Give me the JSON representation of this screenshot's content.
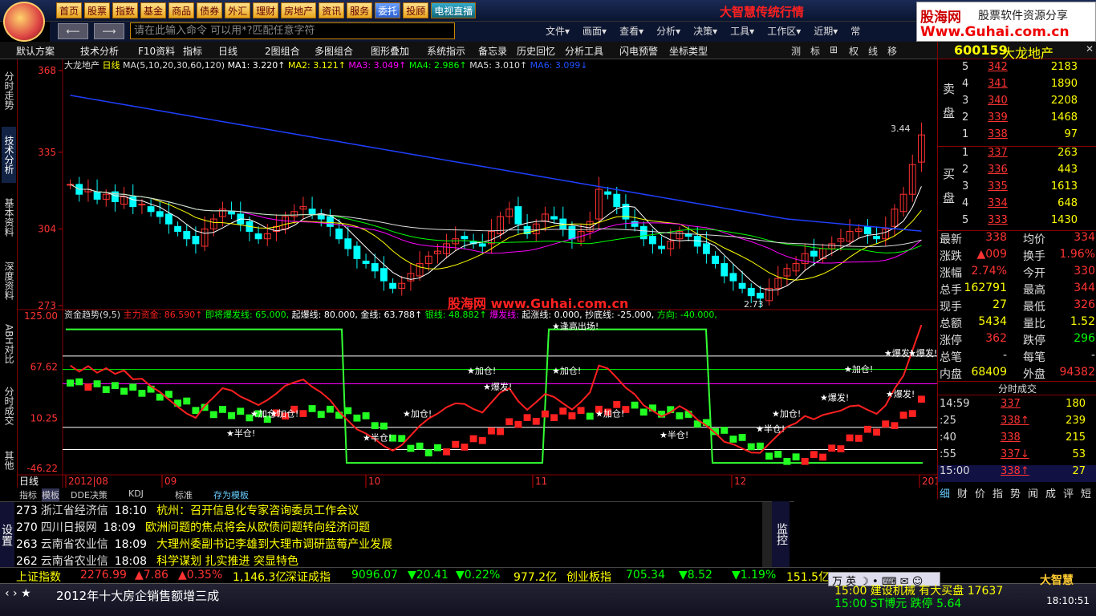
{
  "menu": [
    "首页",
    "股票",
    "指数",
    "基金",
    "商品",
    "债券",
    "外汇",
    "理财",
    "房地产",
    "资讯",
    "服务",
    "委托",
    "投顾",
    "电视直播"
  ],
  "brand": "大智慧传统行情",
  "ad": {
    "name": "股海网",
    "slogan": "股票软件资源分享",
    "url": "Www.Guhai.com.cn"
  },
  "cmd_placeholder": "请在此输入命令  可以用*?匹配任意字符",
  "top_menu": [
    "文件▾",
    "画面▾",
    "查看▾",
    "分析▾",
    "决策▾",
    "工具▾",
    "工作区▾",
    "近期▾",
    "常"
  ],
  "toolbar": [
    "默认方案",
    "技术分析",
    "F10资料",
    "指标",
    "日线",
    "2图组合",
    "多图组合",
    "图形叠加",
    "系统指示",
    "备忘录",
    "历史回忆",
    "分析工具",
    "闪电预警",
    "坐标类型"
  ],
  "toolbar_right": [
    "测",
    "标",
    "⊞",
    "权",
    "线",
    "移"
  ],
  "left_tabs": [
    "分时走势",
    "技术分析",
    "基本资料",
    "深度资料",
    "ABH对比",
    "分时成交",
    "其他"
  ],
  "stock": {
    "code": "600159",
    "name": "大龙地产"
  },
  "ma_line": {
    "title": "大龙地产",
    "period": "日线",
    "params": "MA(5,10,20,30,60,120)",
    "items": [
      {
        "t": "MA1: 3.220↑",
        "c": "#ffffff"
      },
      {
        "t": "MA2: 3.121↑",
        "c": "#ffff00"
      },
      {
        "t": "MA3: 3.049↑",
        "c": "#ff00ff"
      },
      {
        "t": "MA4: 2.986↑",
        "c": "#00ff00"
      },
      {
        "t": "MA5: 3.010↑",
        "c": "#dddddd"
      },
      {
        "t": "MA6: 3.099↓",
        "c": "#2050ff"
      }
    ]
  },
  "price_axis": [
    "368",
    "335",
    "304",
    "273"
  ],
  "high_label": "3.44",
  "low_label": "2.73",
  "ind_line": {
    "title": "资金趋势(9,5)",
    "items": [
      {
        "t": "主力资金: 86.590↑",
        "c": "#ff2020"
      },
      {
        "t": "即将爆发线: 65.000,",
        "c": "#00ff00"
      },
      {
        "t": "起爆线: 80.000,",
        "c": "#ffffff"
      },
      {
        "t": "金线: 63.788↑",
        "c": "#ffffff"
      },
      {
        "t": "银线: 48.882↑",
        "c": "#00ff00"
      },
      {
        "t": "爆发线:",
        "c": "#ff00ff"
      },
      {
        "t": "起涨线: 0.000,",
        "c": "#ffffff"
      },
      {
        "t": "抄底线: -25.000,",
        "c": "#ffffff"
      },
      {
        "t": "方向: -40.000,",
        "c": "#00ff00"
      }
    ]
  },
  "ind_axis": [
    "125.00",
    "67.62",
    "10.25",
    "-46.22"
  ],
  "watermark": "股海网  www.Guhai.com.cn",
  "signals": [
    "加仓!",
    "爆发!",
    "半仓!",
    "逢高出场!"
  ],
  "date_axis": [
    "2012|08",
    "09",
    "10",
    "11",
    "12",
    "2013|01"
  ],
  "period_label": "日线",
  "bottom_tabs": [
    "指标",
    "模板",
    "DDE决策",
    "KDJ",
    "标准",
    "存为模板"
  ],
  "asks": [
    {
      "n": "5",
      "p": "342",
      "v": "2183"
    },
    {
      "n": "4",
      "p": "341",
      "v": "1890"
    },
    {
      "n": "3",
      "p": "340",
      "v": "2208"
    },
    {
      "n": "2",
      "p": "339",
      "v": "1468"
    },
    {
      "n": "1",
      "p": "338",
      "v": "97"
    }
  ],
  "bids": [
    {
      "n": "1",
      "p": "337",
      "v": "263"
    },
    {
      "n": "2",
      "p": "336",
      "v": "443"
    },
    {
      "n": "3",
      "p": "335",
      "v": "1613"
    },
    {
      "n": "4",
      "p": "334",
      "v": "648"
    },
    {
      "n": "5",
      "p": "333",
      "v": "1430"
    }
  ],
  "sell_label": "卖盘",
  "buy_label": "买盘",
  "quote": [
    [
      "最新",
      "338",
      "均价",
      "334"
    ],
    [
      "涨跌",
      "▲009",
      "换手",
      "1.96%"
    ],
    [
      "涨幅",
      "2.74%",
      "今开",
      "330"
    ],
    [
      "总手",
      "162791",
      "最高",
      "344"
    ],
    [
      "现手",
      "27",
      "最低",
      "326"
    ],
    [
      "总额",
      "5434",
      "量比",
      "1.52"
    ],
    [
      "涨停",
      "362",
      "跌停",
      "296"
    ],
    [
      "总笔",
      "-",
      "每笔",
      "-"
    ],
    [
      "内盘",
      "68409",
      "外盘",
      "94382"
    ]
  ],
  "ticks_header": "分时成交",
  "ticks": [
    {
      "t": "14:59",
      "p": "337",
      "v": "180"
    },
    {
      "t": ":25",
      "p": "338↑",
      "v": "239"
    },
    {
      "t": ":40",
      "p": "338",
      "v": "215"
    },
    {
      "t": ":55",
      "p": "337↓",
      "v": "53"
    },
    {
      "t": "15:00",
      "p": "338↑",
      "v": "27"
    }
  ],
  "right_tabs": [
    "细",
    "财",
    "价",
    "指",
    "势",
    "闻",
    "成",
    "评",
    "短"
  ],
  "news": [
    {
      "id": "273",
      "src": "浙江省经济信",
      "tm": "18:10",
      "tx": "杭州：召开信息化专家咨询委员工作会议"
    },
    {
      "id": "270",
      "src": "四川日报网",
      "tm": "18:09",
      "tx": "欧洲问题的焦点将会从欧债问题转向经济问题"
    },
    {
      "id": "263",
      "src": "云南省农业信",
      "tm": "18:09",
      "tx": "大理州委副书记李雄到大理市调研蓝莓产业发展"
    },
    {
      "id": "262",
      "src": "云南省农业信",
      "tm": "18:08",
      "tx": "科学谋划 扎实推进 突显特色"
    }
  ],
  "news_side": "设置",
  "monitor": "监控",
  "ticker": [
    {
      "t": "上证指数",
      "c": "#ffff00"
    },
    {
      "t": "2276.99",
      "c": "#ff3333"
    },
    {
      "t": "▲7.86",
      "c": "#ff3333"
    },
    {
      "t": "▲0.35%",
      "c": "#ff3333"
    },
    {
      "t": "1,146.3亿",
      "c": "#ffff00"
    },
    {
      "t": "深证成指",
      "c": "#ffff00"
    },
    {
      "t": "9096.07",
      "c": "#00ff00"
    },
    {
      "t": "▼20.41",
      "c": "#00ff00"
    },
    {
      "t": "▼0.22%",
      "c": "#00ff00"
    },
    {
      "t": "977.2亿",
      "c": "#ffff00"
    },
    {
      "t": "创业板指",
      "c": "#ffff00"
    },
    {
      "t": "705.34",
      "c": "#00ff00"
    },
    {
      "t": "▼8.52",
      "c": "#00ff00"
    },
    {
      "t": "▼1.19%",
      "c": "#00ff00"
    },
    {
      "t": "151.5亿",
      "c": "#ffff00"
    }
  ],
  "headline": "2012年十大房企销售额增三成",
  "alerts": [
    "15:00 建设机械 有大买盘 17637",
    "15:00 ST博元 跌停 5.64"
  ],
  "clock": "18:10:51",
  "logo2": "大智慧"
}
